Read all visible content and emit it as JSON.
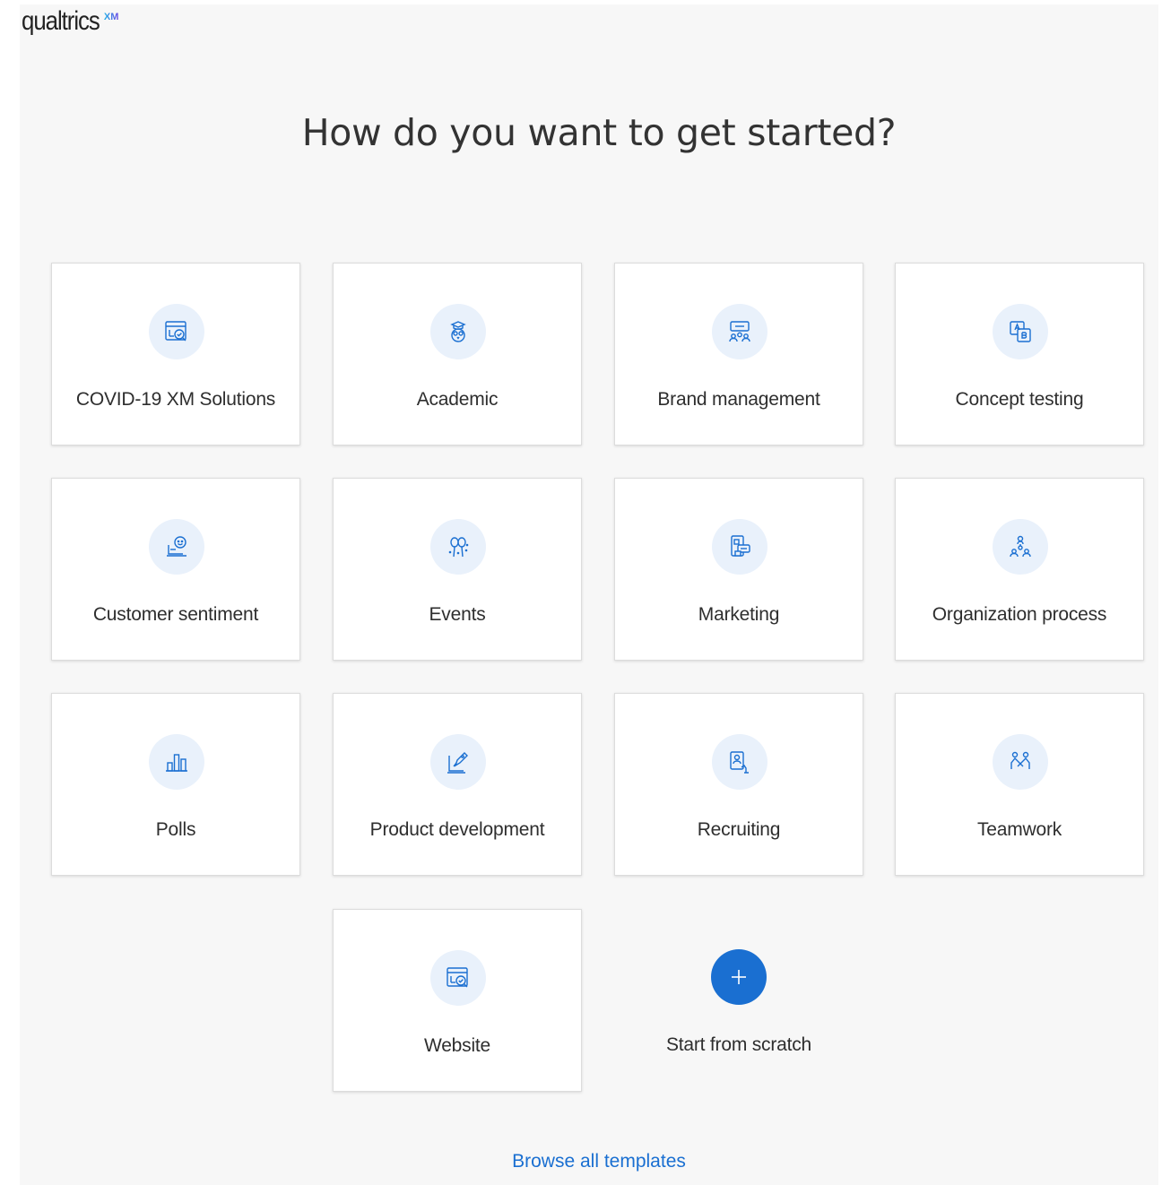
{
  "brand": {
    "name": "qualtrics",
    "badge": "XM"
  },
  "page": {
    "title": "How do you want to get started?"
  },
  "cards": [
    {
      "label": "COVID-19 XM Solutions",
      "icon": "browser-search-icon"
    },
    {
      "label": "Academic",
      "icon": "owl-graduation-icon"
    },
    {
      "label": "Brand management",
      "icon": "audience-screen-icon"
    },
    {
      "label": "Concept testing",
      "icon": "ab-compare-icon"
    },
    {
      "label": "Customer sentiment",
      "icon": "customer-chat-icon"
    },
    {
      "label": "Events",
      "icon": "balloons-icon"
    },
    {
      "label": "Marketing",
      "icon": "phone-message-icon"
    },
    {
      "label": "Organization process",
      "icon": "org-people-icon"
    },
    {
      "label": "Polls",
      "icon": "bar-chart-icon"
    },
    {
      "label": "Product development",
      "icon": "rocket-screen-icon"
    },
    {
      "label": "Recruiting",
      "icon": "candidate-badge-icon"
    },
    {
      "label": "Teamwork",
      "icon": "team-handshake-icon"
    },
    {
      "label": "Website",
      "icon": "browser-search-icon"
    },
    {
      "label": "Start from scratch",
      "icon": "plus-icon"
    }
  ],
  "footer": {
    "browse_label": "Browse all templates"
  },
  "colors": {
    "accent": "#1a6fd1",
    "icon_bg": "#e9f1fb",
    "panel_bg": "#f7f7f7"
  }
}
